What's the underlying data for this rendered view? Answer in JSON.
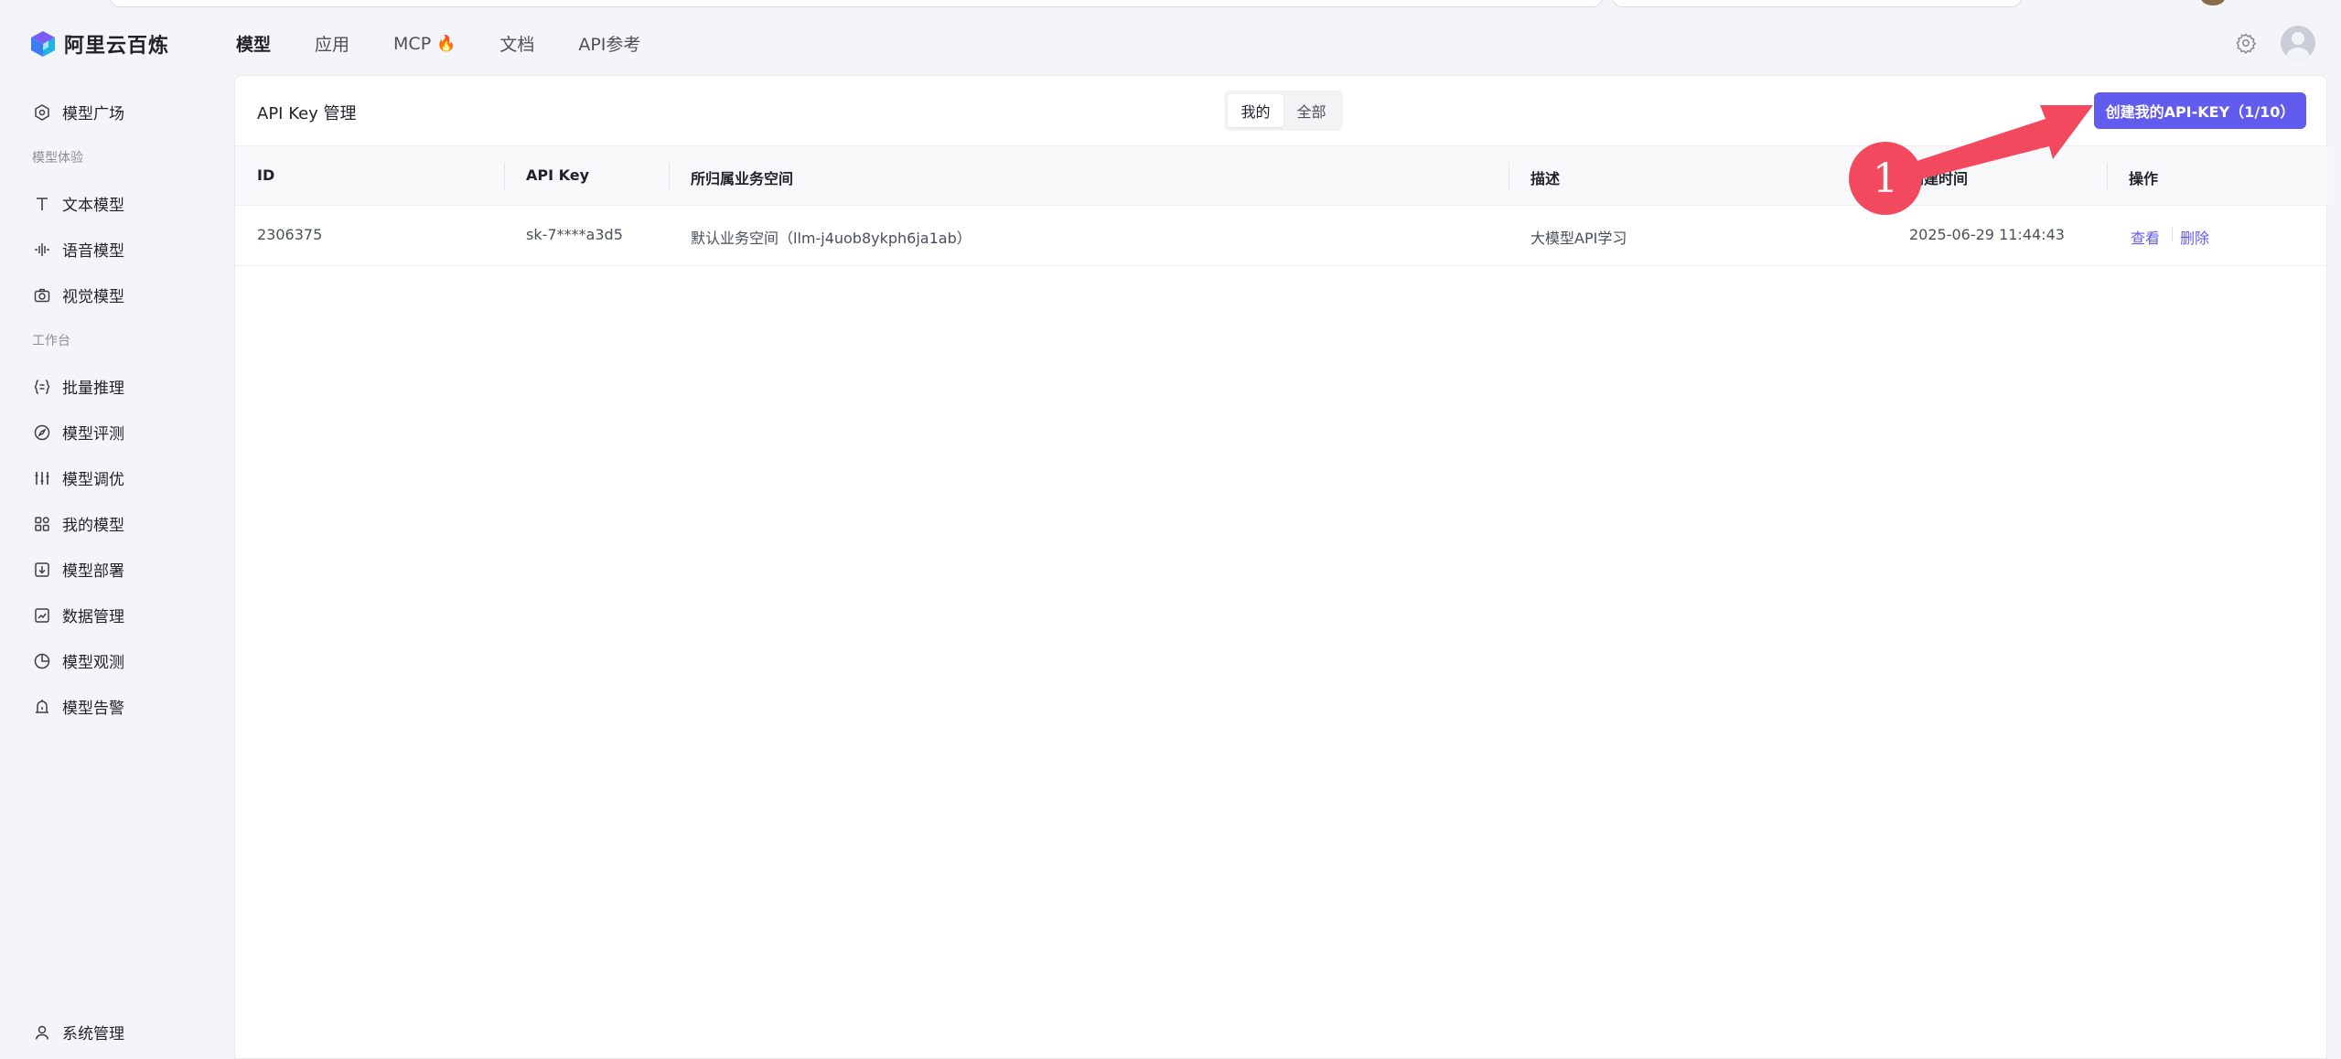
{
  "header": {
    "brand": "阿里云百炼",
    "nav": [
      {
        "label": "模型",
        "active": true
      },
      {
        "label": "应用",
        "active": false
      },
      {
        "label": "MCP",
        "active": false
      },
      {
        "label": "文档",
        "active": false
      },
      {
        "label": "API参考",
        "active": false
      }
    ]
  },
  "sidebar": {
    "top_item": "模型广场",
    "group1": "模型体验",
    "group1_items": [
      "文本模型",
      "语音模型",
      "视觉模型"
    ],
    "group2": "工作台",
    "group2_items": [
      "批量推理",
      "模型评测",
      "模型调优",
      "我的模型",
      "模型部署",
      "数据管理",
      "模型观测",
      "模型告警"
    ],
    "bottom_item": "系统管理"
  },
  "main": {
    "title": "API Key 管理",
    "segments": [
      "我的",
      "全部"
    ],
    "active_segment": "我的",
    "create_button": "创建我的API-KEY（1/10）",
    "columns": [
      "ID",
      "API Key",
      "所归属业务空间",
      "描述",
      "创建时间",
      "操作"
    ],
    "rows": [
      {
        "id": "2306375",
        "api_key": "sk-7****a3d5",
        "workspace": "默认业务空间（llm-j4uob8ykph6ja1ab）",
        "description": "大模型API学习",
        "created": "2025-06-29 11:44:43",
        "actions": [
          "查看",
          "删除"
        ]
      }
    ]
  },
  "annotation": {
    "number": "1",
    "color": "#f2495f"
  },
  "colors": {
    "accent": "#615ced",
    "annotation": "#f2495f"
  }
}
